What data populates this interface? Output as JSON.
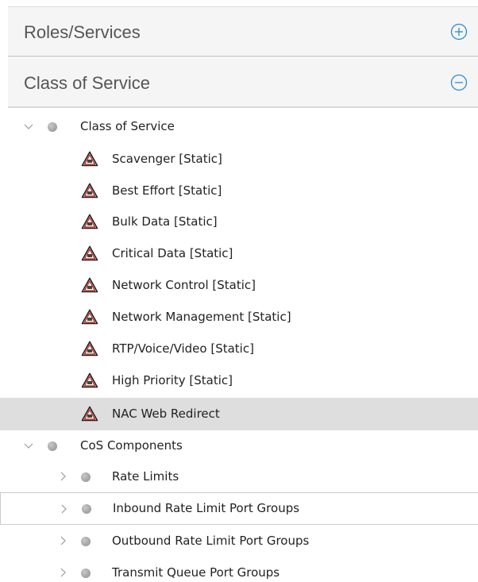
{
  "accordion": {
    "roles_services": {
      "title": "Roles/Services",
      "toggle_icon": "plus-circle-icon"
    },
    "class_of_service": {
      "title": "Class of Service",
      "toggle_icon": "minus-circle-icon"
    }
  },
  "tree": {
    "cos_root": {
      "label": "Class of Service",
      "children": [
        {
          "label": "Scavenger [Static]"
        },
        {
          "label": "Best Effort [Static]"
        },
        {
          "label": "Bulk Data [Static]"
        },
        {
          "label": "Critical Data [Static]"
        },
        {
          "label": "Network Control [Static]"
        },
        {
          "label": "Network Management [Static]"
        },
        {
          "label": "RTP/Voice/Video [Static]"
        },
        {
          "label": "High Priority [Static]"
        },
        {
          "label": "NAC Web Redirect"
        }
      ]
    },
    "components_root": {
      "label": "CoS Components",
      "children": [
        {
          "label": "Rate Limits"
        },
        {
          "label": "Inbound Rate Limit Port Groups"
        },
        {
          "label": "Outbound Rate Limit Port Groups"
        },
        {
          "label": "Transmit Queue Port Groups"
        }
      ]
    }
  },
  "colors": {
    "accent_blue": "#2a8bd4",
    "selected_row": "#dedede",
    "header_bg": "#f5f5f5"
  }
}
